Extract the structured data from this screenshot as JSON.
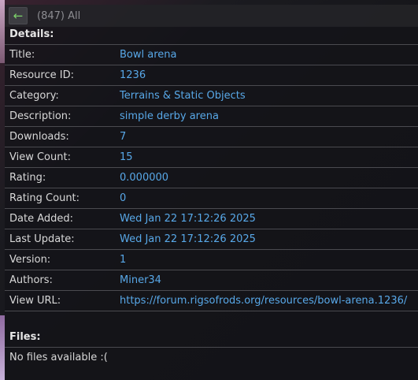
{
  "nav": {
    "back_icon": "←",
    "breadcrumb": "(847) All"
  },
  "details": {
    "heading": "Details:",
    "rows": [
      {
        "label": "Title:",
        "value": "Bowl arena"
      },
      {
        "label": "Resource ID:",
        "value": "1236"
      },
      {
        "label": "Category:",
        "value": "Terrains & Static Objects"
      },
      {
        "label": "Description:",
        "value": "simple derby arena"
      },
      {
        "label": "Downloads:",
        "value": "7"
      },
      {
        "label": "View Count:",
        "value": "15"
      },
      {
        "label": "Rating:",
        "value": "0.000000"
      },
      {
        "label": "Rating Count:",
        "value": "0"
      },
      {
        "label": "Date Added:",
        "value": "Wed Jan 22 17:12:26 2025"
      },
      {
        "label": "Last Update:",
        "value": "Wed Jan 22 17:12:26 2025"
      },
      {
        "label": "Version:",
        "value": "1"
      },
      {
        "label": "Authors:",
        "value": "Miner34"
      },
      {
        "label": "View URL:",
        "value": "https://forum.rigsofrods.org/resources/bowl-arena.1236/"
      }
    ]
  },
  "files": {
    "heading": "Files:",
    "empty_message": "No files available :("
  },
  "colors": {
    "value_link": "#58a8e8",
    "back_arrow": "#7dd36a"
  }
}
